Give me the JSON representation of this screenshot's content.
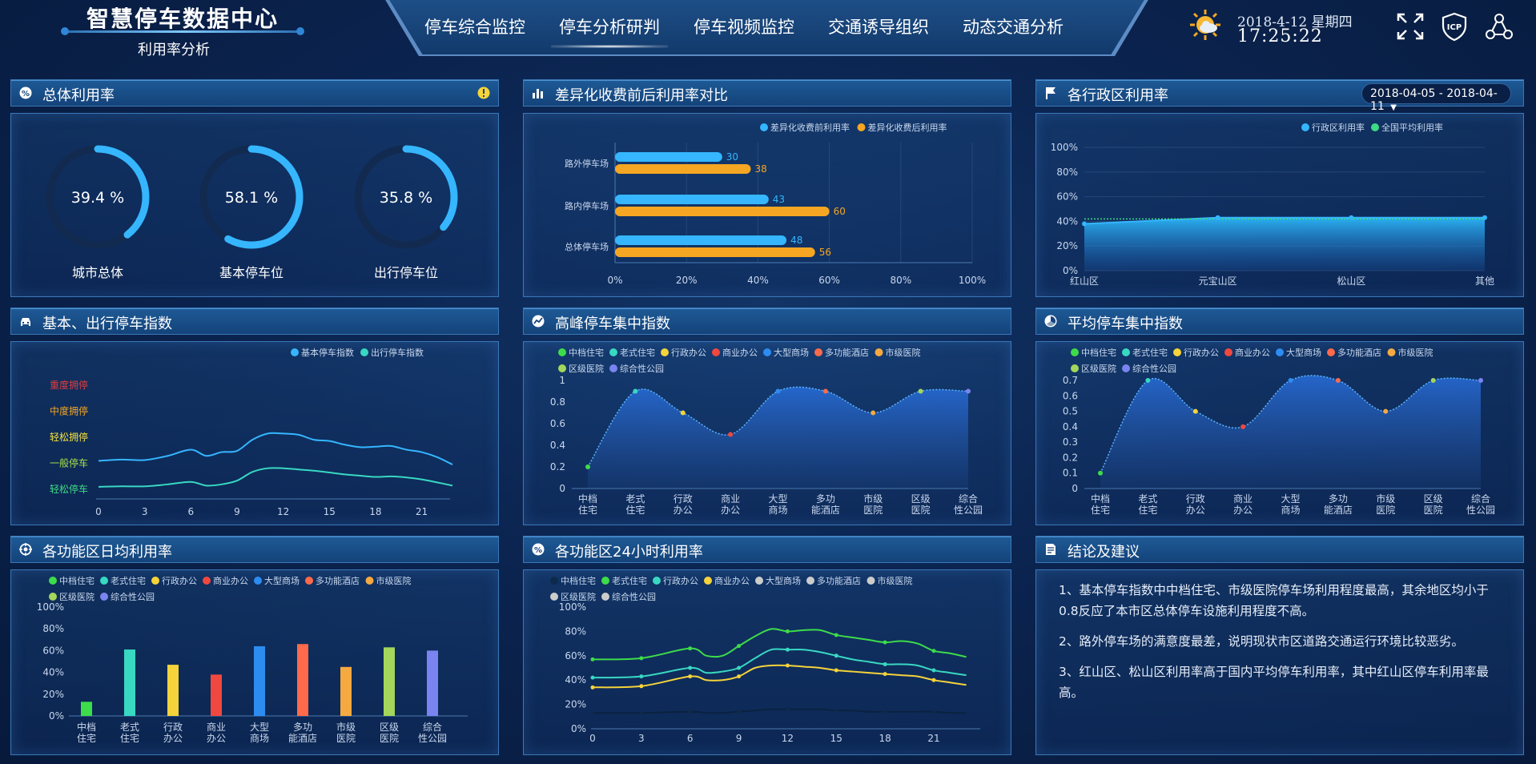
{
  "header": {
    "title": "智慧停车数据中心",
    "subtitle": "利用率分析",
    "nav": [
      "停车综合监控",
      "停车分析研判",
      "停车视频监控",
      "交通诱导组织",
      "动态交通分析"
    ],
    "active_nav": 1,
    "date": "2018-4-12  星期四",
    "time": "17:25:22"
  },
  "panels": {
    "overall": "总体利用率",
    "diff": "差异化收费前后利用率对比",
    "district": "各行政区利用率",
    "basic_index": "基本、出行停车指数",
    "peak": "高峰停车集中指数",
    "avg": "平均停车集中指数",
    "daily": "各功能区日均利用率",
    "hourly": "各功能区24小时利用率",
    "conclusion": "结论及建议"
  },
  "date_range": "2018-04-05 - 2018-04-11",
  "gauges": [
    {
      "label": "城市总体",
      "value_text": "39.4 %",
      "value": 39.4
    },
    {
      "label": "基本停车位",
      "value_text": "58.1 %",
      "value": 58.1
    },
    {
      "label": "出行停车位",
      "value_text": "35.8 %",
      "value": 35.8
    }
  ],
  "colors": {
    "accent": "#35b6ff",
    "orange": "#f5a623",
    "green": "#3ddc84",
    "teal": "#38d8c2",
    "panel_border": "#3a78b8"
  },
  "conclusions": [
    "1、基本停车指数中中档住宅、市级医院停车场利用程度最高，其余地区均小于0.8反应了本市区总体停车设施利用程度不高。",
    "2、路外停车场的满意度最差，说明现状市区道路交通运行环境比较恶劣。",
    "3、红山区、松山区利用率高于国内平均停车利用率，其中红山区停车利用率最高。"
  ],
  "function_zones": [
    "中档住宅",
    "老式住宅",
    "行政办公",
    "商业办公",
    "大型商场",
    "多功能酒店",
    "市级医院",
    "区级医院",
    "综合性公园"
  ],
  "zone_colors": [
    "#3ddc4a",
    "#38d8c2",
    "#f5d33a",
    "#f0483e",
    "#2d8cf0",
    "#ff6a4a",
    "#f5a940",
    "#a3d65a",
    "#7a84f0"
  ],
  "chart_data": [
    {
      "type": "bar",
      "title": "差异化收费前后利用率对比",
      "categories": [
        "总体停车场",
        "路内停车场",
        "路外停车场"
      ],
      "series": [
        {
          "name": "差异化收费前利用率",
          "values": [
            48,
            43,
            30
          ]
        },
        {
          "name": "差异化收费后利用率",
          "values": [
            56,
            60,
            38
          ]
        }
      ],
      "xticks": [
        "0%",
        "20%",
        "40%",
        "60%",
        "80%",
        "100%"
      ],
      "xlim": [
        0,
        100
      ]
    },
    {
      "type": "area",
      "title": "各行政区利用率",
      "categories": [
        "红山区",
        "元宝山区",
        "松山区",
        "其他"
      ],
      "series": [
        {
          "name": "行政区利用率",
          "values": [
            38,
            43,
            43,
            43
          ]
        },
        {
          "name": "全国平均利用率",
          "values": [
            42,
            42,
            42,
            42
          ]
        }
      ],
      "yticks": [
        "100%",
        "80%",
        "60%",
        "40%",
        "20%",
        "0%"
      ],
      "ylim": [
        0,
        100
      ]
    },
    {
      "type": "line",
      "title": "基本、出行停车指数",
      "x": [
        0,
        1.5,
        3,
        4.5,
        6,
        7,
        8,
        9,
        10,
        11,
        12,
        13,
        14,
        15,
        16,
        17,
        18,
        19,
        20,
        21,
        22,
        23
      ],
      "xticks": [
        "0",
        "3",
        "6",
        "9",
        "12",
        "15",
        "18",
        "21"
      ],
      "ylevels": [
        "重度拥停",
        "中度拥停",
        "轻松拥停",
        "一般停车",
        "轻松停车"
      ],
      "ylevel_colors": [
        "#e23b3b",
        "#f5a623",
        "#f5e13a",
        "#a6e04a",
        "#3ddc84"
      ],
      "series": [
        {
          "name": "基本停车指数",
          "values": [
            2.15,
            2.2,
            2.18,
            2.35,
            2.6,
            2.35,
            2.5,
            2.55,
            3.0,
            3.25,
            3.25,
            3.2,
            3.0,
            2.95,
            2.8,
            2.7,
            2.72,
            2.75,
            2.6,
            2.5,
            2.3,
            2.0
          ]
        },
        {
          "name": "出行停车指数",
          "values": [
            1.1,
            1.12,
            1.12,
            1.2,
            1.3,
            1.15,
            1.2,
            1.35,
            1.7,
            1.85,
            1.85,
            1.8,
            1.75,
            1.68,
            1.6,
            1.55,
            1.5,
            1.52,
            1.48,
            1.4,
            1.28,
            1.15
          ]
        }
      ]
    },
    {
      "type": "area",
      "title": "高峰停车集中指数",
      "categories": [
        "中档住宅",
        "老式住宅",
        "行政办公",
        "商业办公",
        "大型商场",
        "多功能酒店",
        "市级医院",
        "区级医院",
        "综合性公园"
      ],
      "values": [
        0.2,
        0.9,
        0.7,
        0.5,
        0.9,
        0.9,
        0.7,
        0.9,
        0.9
      ],
      "yticks": [
        "1",
        "0.8",
        "0.6",
        "0.4",
        "0.2",
        "0"
      ],
      "ylim": [
        0,
        1
      ]
    },
    {
      "type": "area",
      "title": "平均停车集中指数",
      "categories": [
        "中档住宅",
        "老式住宅",
        "行政办公",
        "商业办公",
        "大型商场",
        "多功能酒店",
        "市级医院",
        "区级医院",
        "综合性公园"
      ],
      "values": [
        0.1,
        0.7,
        0.5,
        0.4,
        0.7,
        0.7,
        0.5,
        0.7,
        0.7
      ],
      "yticks": [
        "0.7",
        "0.6",
        "0.5",
        "0.4",
        "0.3",
        "0.2",
        "0.1",
        "0"
      ],
      "ylim": [
        0,
        0.7
      ]
    },
    {
      "type": "bar",
      "title": "各功能区日均利用率",
      "categories": [
        "中档住宅",
        "老式住宅",
        "行政办公",
        "商业办公",
        "大型商场",
        "多功能酒店",
        "市级医院",
        "区级医院",
        "综合性公园"
      ],
      "values": [
        13,
        61,
        47,
        38,
        64,
        66,
        45,
        63,
        60
      ],
      "yticks": [
        "100%",
        "80%",
        "60%",
        "40%",
        "20%",
        "0%"
      ],
      "ylim": [
        0,
        100
      ]
    },
    {
      "type": "line",
      "title": "各功能区24小时利用率",
      "x": [
        0,
        3,
        6,
        7,
        8,
        9,
        10,
        11,
        12,
        13,
        14,
        15,
        16,
        17,
        18,
        19,
        20,
        21,
        22,
        23
      ],
      "xticks": [
        "0",
        "3",
        "6",
        "9",
        "12",
        "15",
        "18",
        "21"
      ],
      "yticks": [
        "100%",
        "80%",
        "60%",
        "40%",
        "20%",
        "0%"
      ],
      "ylim": [
        0,
        100
      ],
      "series": [
        {
          "name": "中档住宅",
          "color": "#0e2a4a",
          "values": [
            13,
            13,
            14,
            13,
            13,
            14,
            15,
            16,
            16,
            16,
            16,
            15,
            15,
            14,
            14,
            14,
            14,
            14,
            13,
            13
          ]
        },
        {
          "name": "老式住宅",
          "color": "#3ddc4a",
          "values": [
            57,
            58,
            66,
            60,
            60,
            68,
            76,
            82,
            80,
            81,
            81,
            77,
            75,
            73,
            71,
            72,
            70,
            64,
            62,
            59
          ]
        },
        {
          "name": "行政办公",
          "color": "#38d8c2",
          "values": [
            42,
            43,
            50,
            46,
            47,
            50,
            58,
            65,
            65,
            65,
            63,
            60,
            57,
            55,
            53,
            53,
            52,
            48,
            46,
            44
          ]
        },
        {
          "name": "商业办公",
          "color": "#f5d33a",
          "values": [
            34,
            35,
            43,
            40,
            40,
            43,
            50,
            52,
            52,
            51,
            50,
            48,
            47,
            46,
            45,
            44,
            43,
            40,
            38,
            36
          ]
        },
        {
          "name": "大型商场",
          "color": "#cccccc",
          "values": []
        },
        {
          "name": "多功能酒店",
          "color": "#cccccc",
          "values": []
        },
        {
          "name": "市级医院",
          "color": "#cccccc",
          "values": []
        },
        {
          "name": "区级医院",
          "color": "#cccccc",
          "values": []
        },
        {
          "name": "综合性公园",
          "color": "#cccccc",
          "values": []
        }
      ]
    }
  ]
}
